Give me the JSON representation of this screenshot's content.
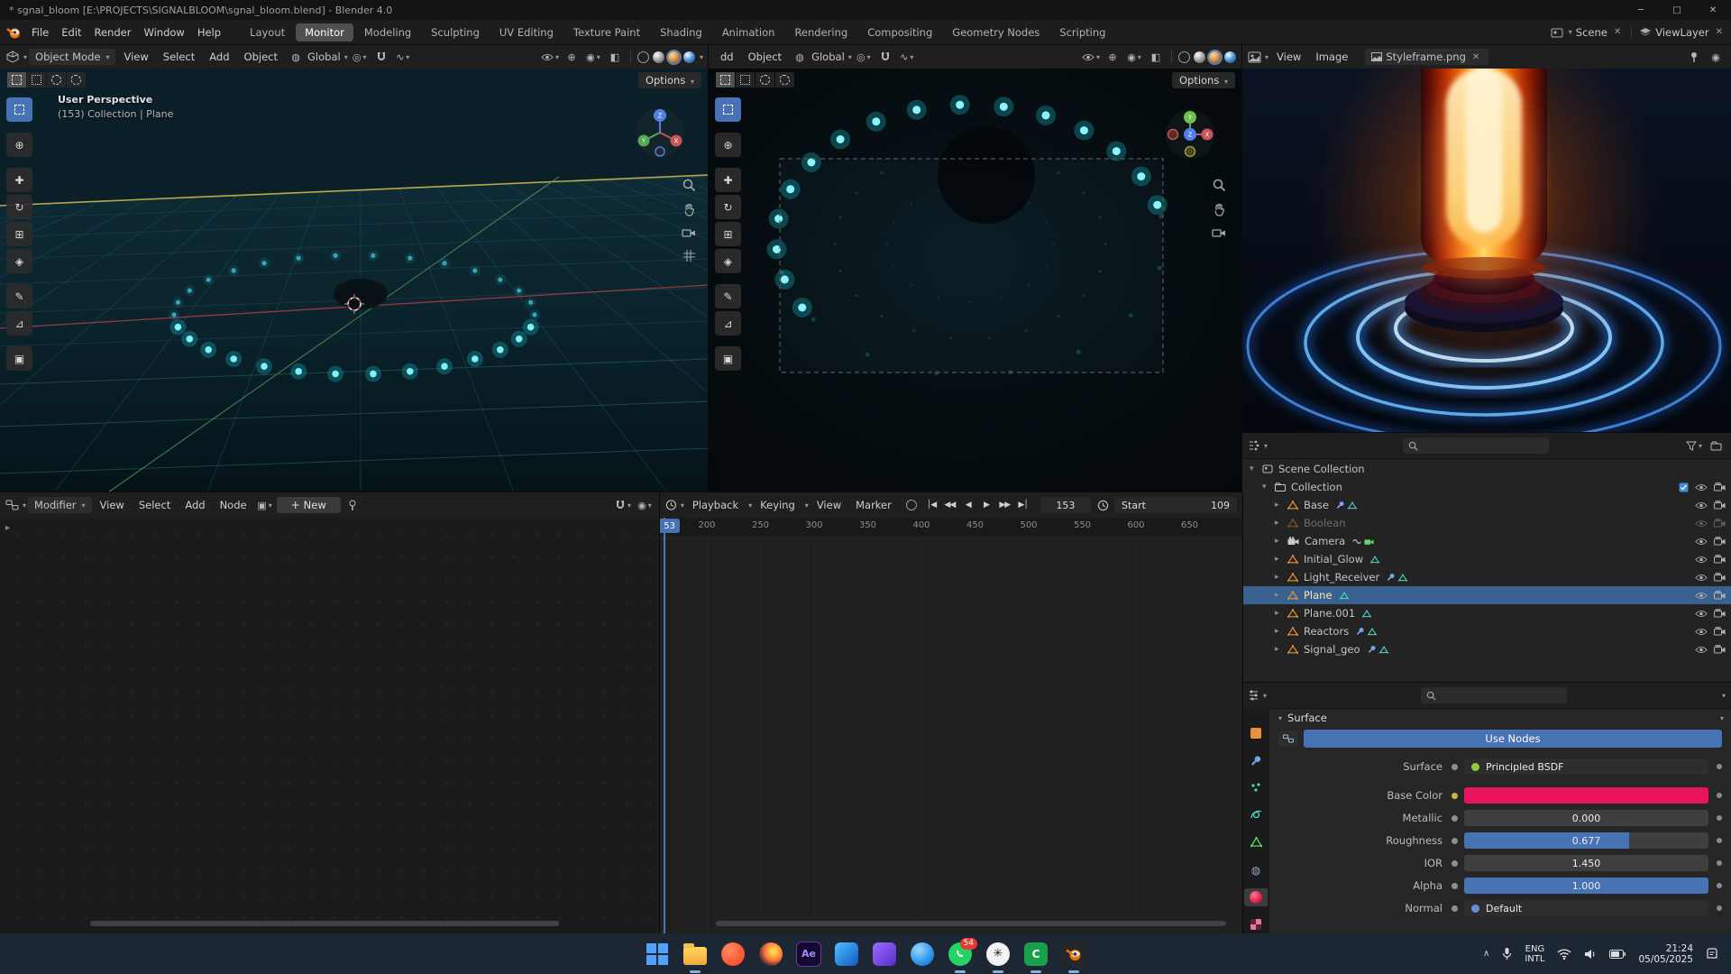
{
  "window": {
    "title": "*  sgnal_bloom [E:\\PROJECTS\\SIGNALBLOOM\\sgnal_bloom.blend] - Blender 4.0",
    "controls": {
      "minimize": "─",
      "maximize": "□",
      "close": "✕"
    }
  },
  "topbar": {
    "menus": [
      "File",
      "Edit",
      "Render",
      "Window",
      "Help"
    ],
    "tabs": [
      {
        "label": "Layout"
      },
      {
        "label": "Monitor",
        "active": true
      },
      {
        "label": "Modeling"
      },
      {
        "label": "Sculpting"
      },
      {
        "label": "UV Editing"
      },
      {
        "label": "Texture Paint"
      },
      {
        "label": "Shading"
      },
      {
        "label": "Animation"
      },
      {
        "label": "Rendering"
      },
      {
        "label": "Compositing"
      },
      {
        "label": "Geometry Nodes"
      },
      {
        "label": "Scripting"
      }
    ],
    "scene_label": "Scene",
    "viewlayer_label": "ViewLayer"
  },
  "viewport_left": {
    "header": {
      "mode": "Object Mode",
      "menus": [
        "View",
        "Select",
        "Add",
        "Object"
      ],
      "orientation": "Global"
    },
    "overlay_title": "User Perspective",
    "overlay_context": "(153) Collection | Plane",
    "options_label": "Options"
  },
  "viewport_mid": {
    "header": {
      "menu_truncated": "dd",
      "object_menu": "Object",
      "orientation": "Global"
    },
    "options_label": "Options"
  },
  "image_editor": {
    "menus": [
      "View",
      "Image"
    ],
    "image_name": "Styleframe.png"
  },
  "outliner": {
    "root_label": "Scene Collection",
    "collection_label": "Collection",
    "items": [
      {
        "name": "Base",
        "extras": [
          "wrench",
          "tri"
        ]
      },
      {
        "name": "Boolean",
        "dimmed": true,
        "extras": []
      },
      {
        "name": "Camera",
        "icon": "camera",
        "extras": [
          "link",
          "camdata"
        ]
      },
      {
        "name": "Initial_Glow",
        "extras": [
          "tri"
        ]
      },
      {
        "name": "Light_Receiver",
        "extras": [
          "wrench",
          "tri"
        ]
      },
      {
        "name": "Plane",
        "selected": true,
        "extras": [
          "tri"
        ]
      },
      {
        "name": "Plane.001",
        "extras": [
          "tri"
        ]
      },
      {
        "name": "Reactors",
        "extras": [
          "wrench",
          "tri"
        ]
      },
      {
        "name": "Signal_geo",
        "extras": [
          "wrench",
          "tri"
        ]
      }
    ]
  },
  "properties": {
    "panel_label": "Surface",
    "use_nodes_label": "Use Nodes",
    "rows": [
      {
        "label": "Surface",
        "kind": "dropdown",
        "value": "Principled BSDF",
        "socket": "#8fce3a"
      },
      {
        "label": "Base Color",
        "kind": "color",
        "value": "",
        "color": "#e8155e",
        "socket": "#c9b43a"
      },
      {
        "label": "Metallic",
        "kind": "slider",
        "value": "0.000",
        "fill": 0.0
      },
      {
        "label": "Roughness",
        "kind": "slider",
        "value": "0.677",
        "fill": 0.677
      },
      {
        "label": "IOR",
        "kind": "field",
        "value": "1.450"
      },
      {
        "label": "Alpha",
        "kind": "slider",
        "value": "1.000",
        "fill": 1.0
      },
      {
        "label": "Normal",
        "kind": "dropdown",
        "value": "Default",
        "socket": "#6a8fd8"
      }
    ]
  },
  "node_editor": {
    "mode_label": "Modifier",
    "menus": [
      "View",
      "Select",
      "Add",
      "Node"
    ],
    "new_label": "New"
  },
  "timeline": {
    "menus": [
      "Playback",
      "Keying",
      "View",
      "Marker"
    ],
    "transport": [
      "│◀",
      "◀◀",
      "◀",
      "▶",
      "▶▶",
      "▶│"
    ],
    "current_frame": "153",
    "start_label": "Start",
    "start_value": "109",
    "playhead_label": "53",
    "ticks": [
      "200",
      "250",
      "300",
      "350",
      "400",
      "450",
      "500",
      "550",
      "600",
      "650"
    ]
  },
  "taskbar": {
    "apps": [
      {
        "name": "start-button",
        "type": "win"
      },
      {
        "name": "file-explorer",
        "type": "folder",
        "running": true
      },
      {
        "name": "brave-browser",
        "type": "brave"
      },
      {
        "name": "firefox-browser",
        "type": "firefox"
      },
      {
        "name": "after-effects",
        "type": "ae",
        "text": "Ae"
      },
      {
        "name": "app-blue",
        "type": "blue"
      },
      {
        "name": "app-purple",
        "type": "purple"
      },
      {
        "name": "app-circle-blue",
        "type": "bluecirc"
      },
      {
        "name": "whatsapp",
        "type": "whatsapp",
        "badge": "54",
        "running": true
      },
      {
        "name": "chatgpt",
        "type": "gpt",
        "text": "✳",
        "running": true
      },
      {
        "name": "app-green-c",
        "type": "greenc",
        "text": "C",
        "running": true
      },
      {
        "name": "blender-app",
        "type": "blender",
        "running": true
      }
    ],
    "tray": {
      "chevron": "∧",
      "lang1": "ENG",
      "lang2": "INTL",
      "time": "21:24",
      "date": "05/05/2025"
    }
  }
}
